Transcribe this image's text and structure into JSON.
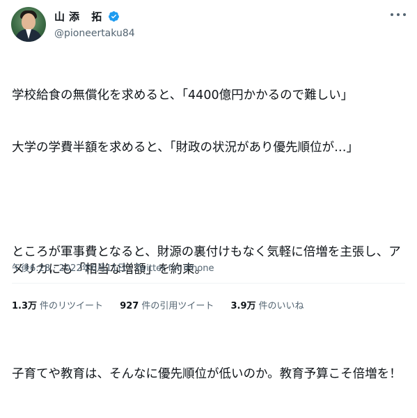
{
  "author": {
    "display_name": "山添 拓",
    "handle": "@pioneertaku84",
    "verified_color": "#1d9bf0"
  },
  "tweet": {
    "lines": [
      "学校給食の無償化を求めると、「4400億円かかるので難しい」",
      "大学の学費半額を求めると、「財政の状況があり優先順位が…」",
      "",
      "ところが軍事費となると、財源の裏付けもなく気軽に倍増を主張し、アメリカにも「相当な増額」を約束。",
      "",
      "子育てや教育は、そんなに優先順位が低いのか。教育予算こそ倍増を！"
    ]
  },
  "meta": {
    "time": "午後6:28",
    "separator": "·",
    "date": "2022年6月11日",
    "source": "Twitter for iPhone"
  },
  "stats": {
    "retweets_count": "1.3万",
    "retweets_label": "件のリツイート",
    "quotes_count": "927",
    "quotes_label": "件の引用ツイート",
    "likes_count": "3.9万",
    "likes_label": "件のいいね"
  },
  "icons": {
    "avatar": "profile-photo",
    "verified": "verified-badge-icon",
    "more": "more-options-icon"
  }
}
